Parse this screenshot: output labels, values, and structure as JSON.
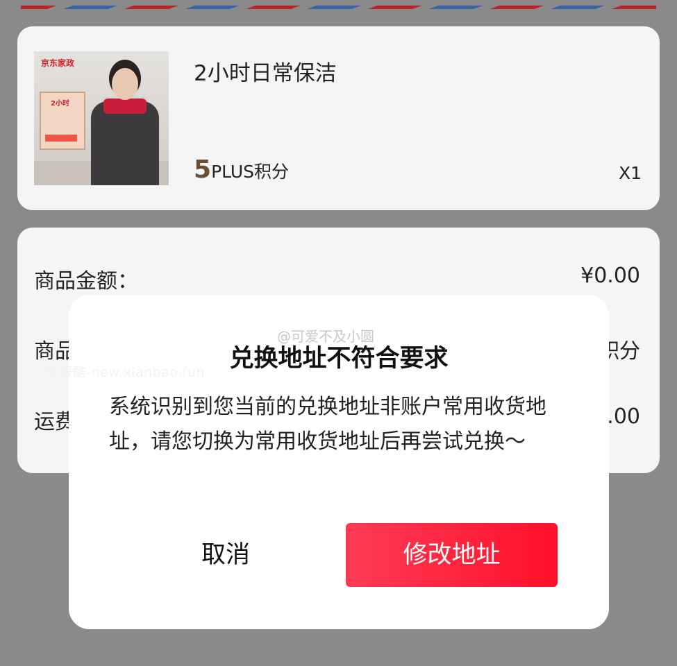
{
  "product": {
    "name": "2小时日常保洁",
    "price_number": "5",
    "price_unit": "PLUS积分",
    "quantity": "X1",
    "image_brand": "京东家政",
    "image_poster_text": "2小时"
  },
  "summary": {
    "rows": [
      {
        "label": "商品金额：",
        "value": "¥0.00"
      },
      {
        "label": "商品",
        "value": "积分"
      },
      {
        "label": "运费",
        "value": ".00"
      }
    ]
  },
  "watermark": "线报酷-new.xianbao.fun",
  "modal": {
    "credit": "@可爱不及小圆",
    "title": "兑换地址不符合要求",
    "body": "系统识别到您当前的兑换地址非账户常用收货地址，请您切换为常用收货地址后再尝试兑换～",
    "cancel_label": "取消",
    "confirm_label": "修改地址",
    "confirm_color": "#ff1f3a"
  }
}
